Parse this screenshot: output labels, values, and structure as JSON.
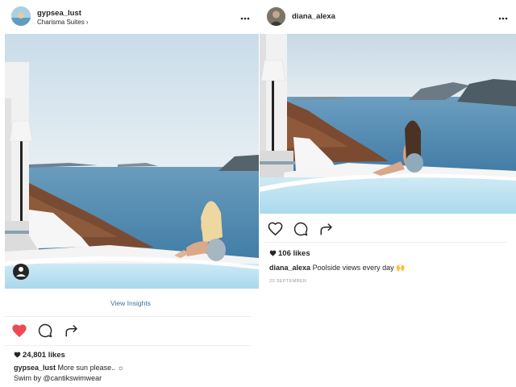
{
  "left_post": {
    "username": "gypsea_lust",
    "location": "Charisma Suites",
    "location_chevron": "›",
    "more_icon": "more-horizontal-icon",
    "insights_label": "View Insights",
    "liked": true,
    "like_color": "#ed4956",
    "likes": "24,801 likes",
    "caption_username": "gypsea_lust",
    "caption_text": "More sun please.. ☼",
    "caption_line2": "Swim by @cantikswimwear"
  },
  "right_post": {
    "username": "diana_alexa",
    "more_icon": "more-horizontal-icon",
    "liked": false,
    "likes": "106 likes",
    "caption_username": "diana_alexa",
    "caption_text": "Poolside views every day 🙌",
    "date": "20 SEPTEMBER"
  },
  "colors": {
    "link": "#3f729b",
    "sky": "#dbe9f2",
    "sea": "#5d8fb0",
    "pool": "#bfe4f2"
  }
}
